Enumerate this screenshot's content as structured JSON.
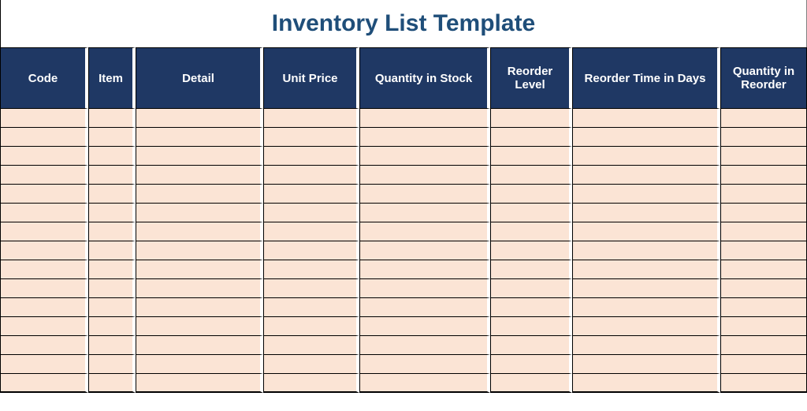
{
  "title": "Inventory List Template",
  "columns": [
    {
      "key": "code",
      "label": "Code"
    },
    {
      "key": "item",
      "label": "Item"
    },
    {
      "key": "detail",
      "label": "Detail"
    },
    {
      "key": "price",
      "label": "Unit Price"
    },
    {
      "key": "stock",
      "label": "Quantity in Stock"
    },
    {
      "key": "level",
      "label": "Reorder Level"
    },
    {
      "key": "time",
      "label": "Reorder Time in Days"
    },
    {
      "key": "qty",
      "label": "Quantity in Reorder"
    }
  ],
  "rows": [
    {
      "code": "",
      "item": "",
      "detail": "",
      "price": "",
      "stock": "",
      "level": "",
      "time": "",
      "qty": ""
    },
    {
      "code": "",
      "item": "",
      "detail": "",
      "price": "",
      "stock": "",
      "level": "",
      "time": "",
      "qty": ""
    },
    {
      "code": "",
      "item": "",
      "detail": "",
      "price": "",
      "stock": "",
      "level": "",
      "time": "",
      "qty": ""
    },
    {
      "code": "",
      "item": "",
      "detail": "",
      "price": "",
      "stock": "",
      "level": "",
      "time": "",
      "qty": ""
    },
    {
      "code": "",
      "item": "",
      "detail": "",
      "price": "",
      "stock": "",
      "level": "",
      "time": "",
      "qty": ""
    },
    {
      "code": "",
      "item": "",
      "detail": "",
      "price": "",
      "stock": "",
      "level": "",
      "time": "",
      "qty": ""
    },
    {
      "code": "",
      "item": "",
      "detail": "",
      "price": "",
      "stock": "",
      "level": "",
      "time": "",
      "qty": ""
    },
    {
      "code": "",
      "item": "",
      "detail": "",
      "price": "",
      "stock": "",
      "level": "",
      "time": "",
      "qty": ""
    },
    {
      "code": "",
      "item": "",
      "detail": "",
      "price": "",
      "stock": "",
      "level": "",
      "time": "",
      "qty": ""
    },
    {
      "code": "",
      "item": "",
      "detail": "",
      "price": "",
      "stock": "",
      "level": "",
      "time": "",
      "qty": ""
    },
    {
      "code": "",
      "item": "",
      "detail": "",
      "price": "",
      "stock": "",
      "level": "",
      "time": "",
      "qty": ""
    },
    {
      "code": "",
      "item": "",
      "detail": "",
      "price": "",
      "stock": "",
      "level": "",
      "time": "",
      "qty": ""
    },
    {
      "code": "",
      "item": "",
      "detail": "",
      "price": "",
      "stock": "",
      "level": "",
      "time": "",
      "qty": ""
    },
    {
      "code": "",
      "item": "",
      "detail": "",
      "price": "",
      "stock": "",
      "level": "",
      "time": "",
      "qty": ""
    },
    {
      "code": "",
      "item": "",
      "detail": "",
      "price": "",
      "stock": "",
      "level": "",
      "time": "",
      "qty": ""
    }
  ]
}
